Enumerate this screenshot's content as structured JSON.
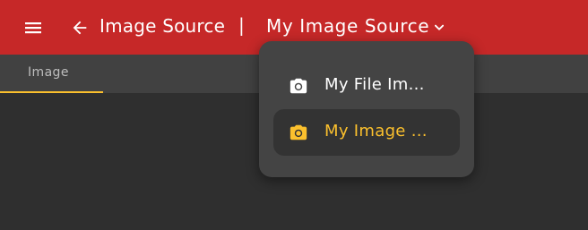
{
  "header": {
    "title": "Image Source",
    "separator": "|",
    "selected_source": "My Image Source",
    "menu_icon": "hamburger-menu-icon",
    "back_icon": "arrow-left-icon",
    "dropdown_icon": "chevron-down-icon"
  },
  "tabs": [
    {
      "label": "Image",
      "active": true
    }
  ],
  "dropdown": {
    "items": [
      {
        "label": "My File Im...",
        "icon": "camera-icon",
        "selected": false
      },
      {
        "label": "My Image ...",
        "icon": "camera-icon",
        "selected": true
      }
    ]
  },
  "colors": {
    "header_bg": "#c62828",
    "tabbar_bg": "#414141",
    "content_bg": "#2f2f2f",
    "accent": "#fbc02d",
    "menu_bg": "#444444",
    "selected_item_bg": "#333333"
  }
}
